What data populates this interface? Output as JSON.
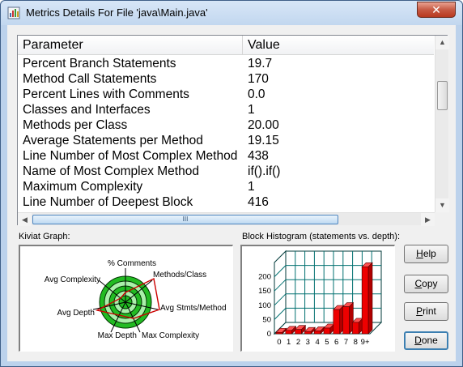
{
  "window": {
    "title": "Metrics Details For File 'java\\Main.java'",
    "close_label": "✕"
  },
  "metrics_table": {
    "headers": [
      "Parameter",
      "Value"
    ],
    "rows": [
      {
        "parameter": "Percent Branch Statements",
        "value": "19.7"
      },
      {
        "parameter": "Method Call Statements",
        "value": "170"
      },
      {
        "parameter": "Percent Lines with Comments",
        "value": "0.0"
      },
      {
        "parameter": "Classes and Interfaces",
        "value": "1"
      },
      {
        "parameter": "Methods per Class",
        "value": "20.00"
      },
      {
        "parameter": "Average Statements per Method",
        "value": "19.15"
      },
      {
        "parameter": "Line Number of Most Complex Method",
        "value": "438"
      },
      {
        "parameter": "Name of Most Complex Method",
        "value": "if().if()"
      },
      {
        "parameter": "Maximum Complexity",
        "value": "1"
      },
      {
        "parameter": "Line Number of Deepest Block",
        "value": "416"
      }
    ],
    "hscroll_grip": "III"
  },
  "kiviat": {
    "label": "Kiviat Graph:",
    "axes": [
      "% Comments",
      "Methods/Class",
      "Avg Stmts/Method",
      "Max Complexity",
      "Max Depth",
      "Avg Depth",
      "Avg Complexity"
    ]
  },
  "histogram": {
    "label": "Block Histogram (statements vs. depth):",
    "y_ticks": [
      "0",
      "50",
      "100",
      "150",
      "200"
    ],
    "categories": [
      "0",
      "1",
      "2",
      "3",
      "4",
      "5",
      "6",
      "7",
      "8",
      "9+"
    ],
    "values": [
      5,
      12,
      15,
      8,
      10,
      20,
      85,
      95,
      40,
      235
    ],
    "ymax": 250,
    "bar_color": "#ee0000"
  },
  "buttons": {
    "help": "H",
    "help_rest": "elp",
    "copy": "C",
    "copy_rest": "opy",
    "print": "P",
    "print_rest": "rint",
    "done": "D",
    "done_rest": "one"
  }
}
